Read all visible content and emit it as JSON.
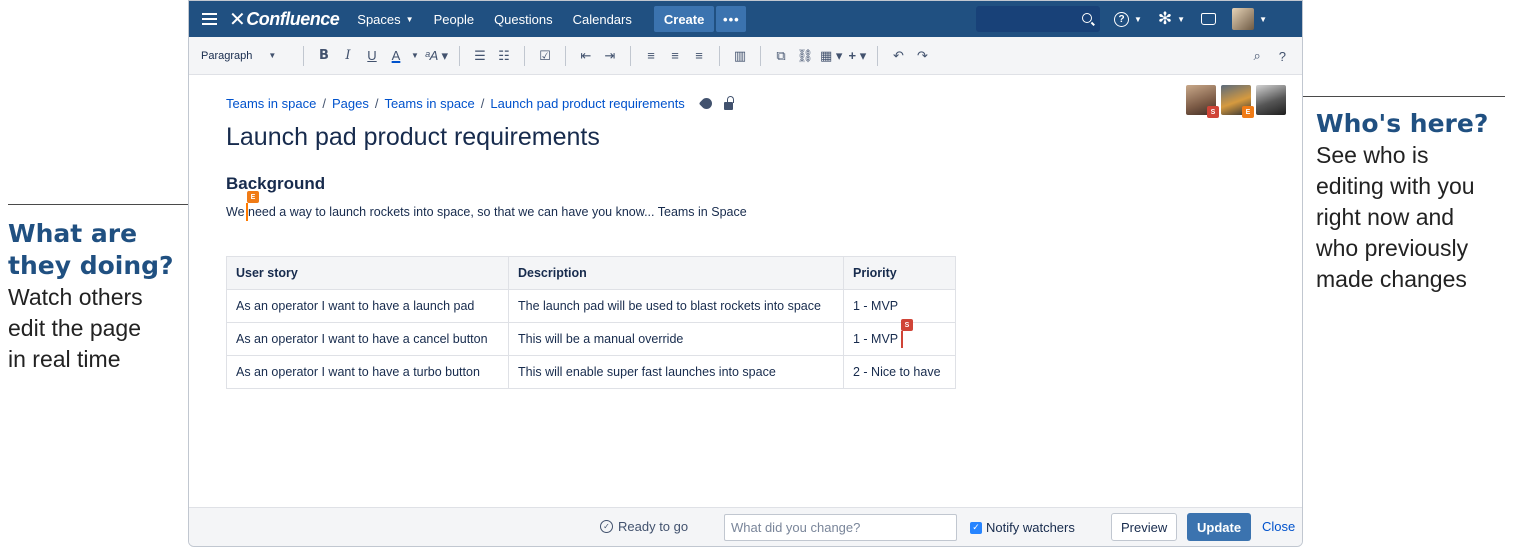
{
  "callouts": {
    "left": {
      "title_line1": "What are",
      "title_line2": "they doing?",
      "body_line1": "Watch others",
      "body_line2": "edit the page",
      "body_line3": "in real time"
    },
    "right": {
      "title": "Who's here?",
      "body_line1": "See who is",
      "body_line2": "editing with you",
      "body_line3": "right now and",
      "body_line4": "who previously",
      "body_line5": "made changes"
    }
  },
  "topnav": {
    "logo": "Confluence",
    "items": [
      "Spaces",
      "People",
      "Questions",
      "Calendars"
    ],
    "create_label": "Create",
    "more_label": "•••"
  },
  "toolbar": {
    "paragraph_label": "Paragraph"
  },
  "breadcrumb": [
    "Teams in space",
    "Pages",
    "Teams in space",
    "Launch pad product requirements"
  ],
  "page": {
    "title": "Launch pad product requirements",
    "section_heading": "Background",
    "body_text": "We need a way to launch rockets into space, so that we can have you know... Teams in Space"
  },
  "table": {
    "headers": [
      "User story",
      "Description",
      "Priority"
    ],
    "rows": [
      [
        "As an operator I want to have a launch pad",
        "The launch pad will be used to blast rockets into space",
        "1 - MVP"
      ],
      [
        "As an operator I want to have a cancel button",
        "This will be a manual override",
        "1 - MVP"
      ],
      [
        "As an operator I want to have a turbo button",
        "This will enable super fast launches into space",
        "2 - Nice to have"
      ]
    ]
  },
  "collaborators": [
    {
      "badge": "S",
      "badge_color": "#d04437"
    },
    {
      "badge": "E",
      "badge_color": "#f07b16"
    },
    {
      "badge": "",
      "badge_color": ""
    }
  ],
  "cursors": {
    "editor_e": {
      "badge": "E",
      "color": "#f07b16"
    },
    "editor_s": {
      "badge": "S",
      "color": "#d04437"
    }
  },
  "footer": {
    "status": "Ready to go",
    "change_placeholder": "What did you change?",
    "notify_label": "Notify watchers",
    "preview_label": "Preview",
    "update_label": "Update",
    "close_label": "Close"
  },
  "colors": {
    "nav_bg": "#205081",
    "accent": "#3b73af",
    "link": "#0052cc"
  }
}
